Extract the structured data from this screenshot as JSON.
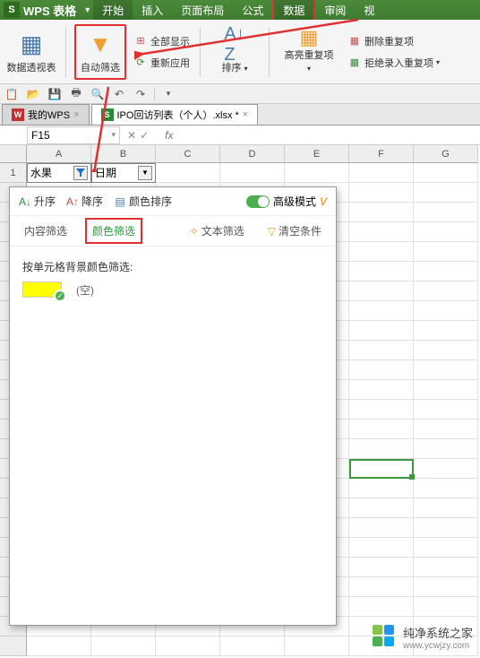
{
  "titlebar": {
    "app_name": "WPS 表格",
    "tabs": [
      "开始",
      "插入",
      "页面布局",
      "公式",
      "数据",
      "审阅",
      "视"
    ]
  },
  "ribbon": {
    "pivot": "数据透视表",
    "auto_filter": "自动筛选",
    "show_all": "全部显示",
    "reapply": "重新应用",
    "sort": "排序",
    "highlight_dup": "高亮重复项",
    "del_dup": "删除重复项",
    "reject_dup": "拒绝录入重复项"
  },
  "doctabs": {
    "tab1": "我的WPS",
    "tab2": "IPO回访列表（个人）.xlsx *"
  },
  "namebox": {
    "value": "F15"
  },
  "columns": [
    "A",
    "B",
    "C",
    "D",
    "E",
    "F",
    "G"
  ],
  "row1": {
    "num": "1",
    "a": "水果",
    "b": "日期"
  },
  "filter_panel": {
    "sort_asc": "升序",
    "sort_desc": "降序",
    "color_sort": "颜色排序",
    "adv_mode": "高级模式",
    "tab_content": "内容筛选",
    "tab_color": "颜色筛选",
    "tab_text": "文本筛选",
    "clear": "清空条件",
    "body_title": "按单元格背景颜色筛选:",
    "empty_label": "(空)"
  },
  "watermark": {
    "text": "纯净系统之家",
    "url": "www.ycwjzy.com"
  }
}
